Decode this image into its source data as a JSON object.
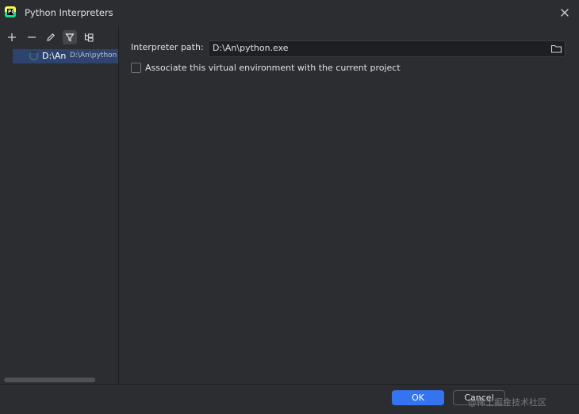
{
  "window": {
    "title": "Python Interpreters",
    "app_icon": "pycharm-icon",
    "app_icon_text": "PC"
  },
  "toolbar": {
    "icons": [
      "add-icon",
      "remove-icon",
      "edit-icon",
      "filter-icon",
      "tree-icon"
    ]
  },
  "interpreters": [
    {
      "name": "D:\\An",
      "path": "D:\\An\\python"
    }
  ],
  "details": {
    "path_label": "Interpreter path:",
    "path_value": "D:\\An\\python.exe",
    "associate_label": "Associate this virtual environment with the current project",
    "associate_checked": false
  },
  "buttons": {
    "ok": "OK",
    "cancel": "Cancel"
  },
  "watermark": "@稀土掘金技术社区",
  "colors": {
    "background": "#2b2d30",
    "selection": "#2e436e",
    "primary": "#3574f0"
  }
}
